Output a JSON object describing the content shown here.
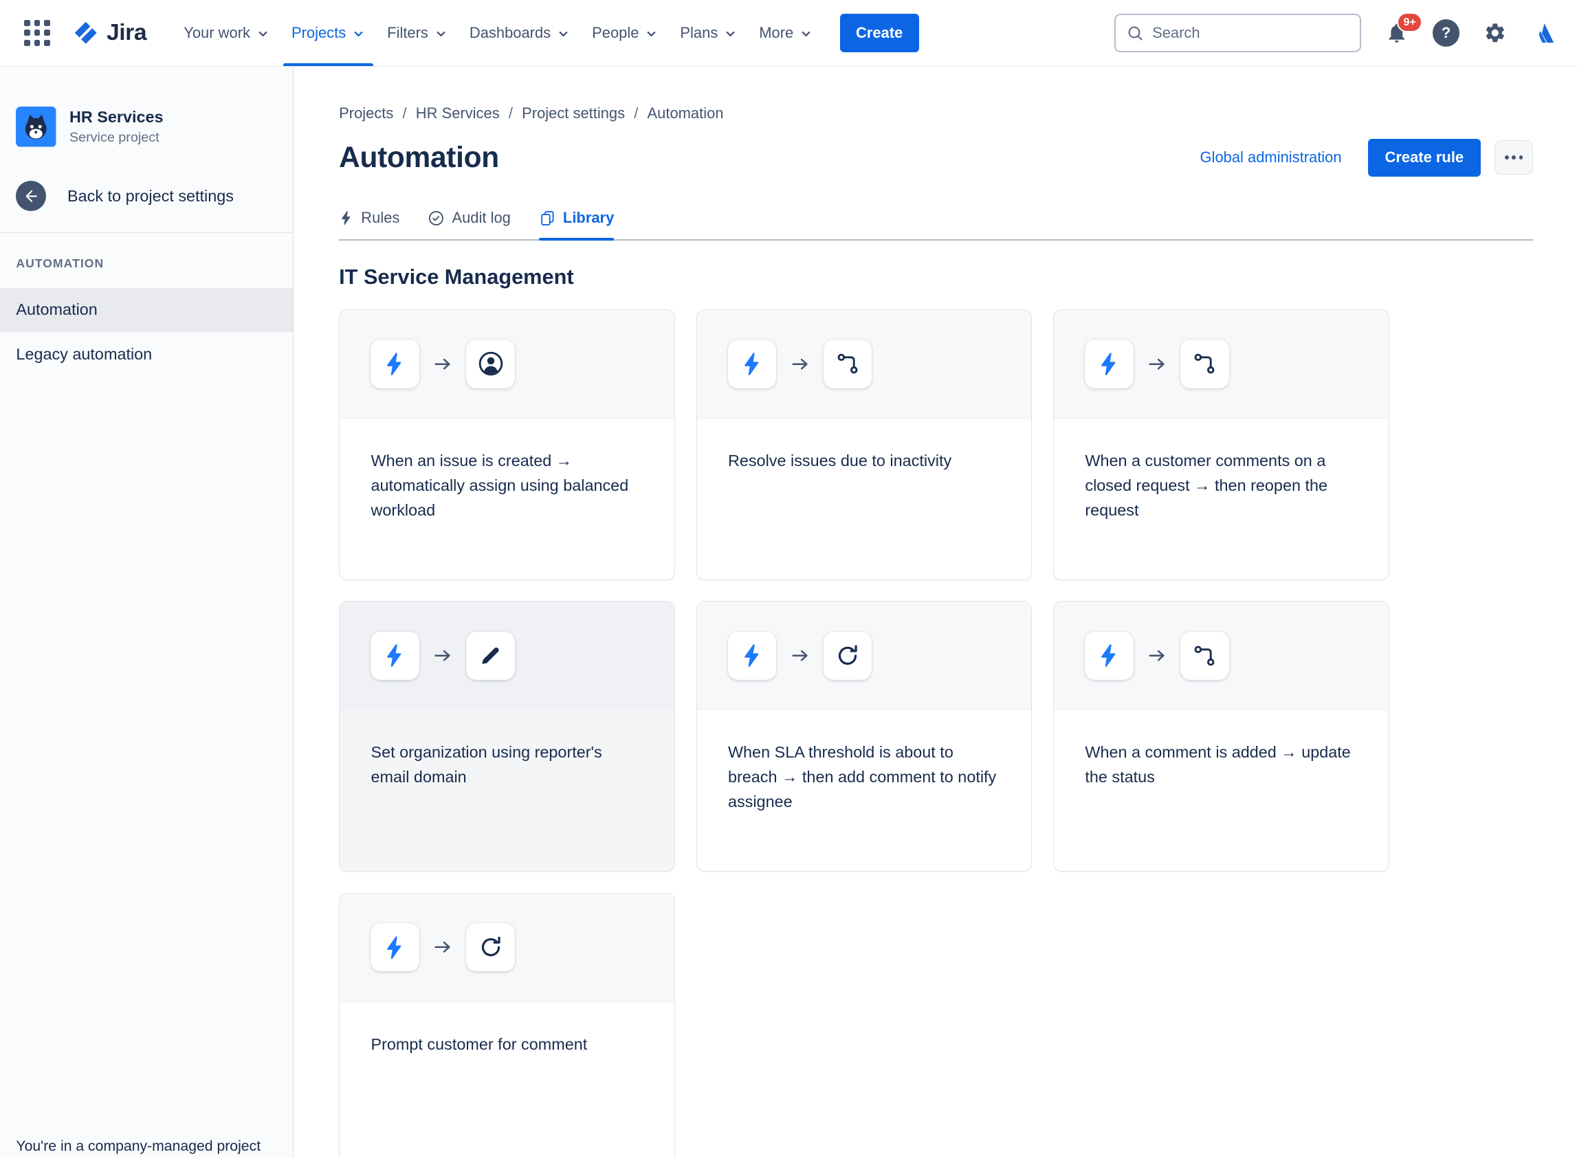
{
  "topbar": {
    "logo_text": "Jira",
    "nav": [
      {
        "label": "Your work"
      },
      {
        "label": "Projects",
        "active": true
      },
      {
        "label": "Filters"
      },
      {
        "label": "Dashboards"
      },
      {
        "label": "People"
      },
      {
        "label": "Plans"
      },
      {
        "label": "More"
      }
    ],
    "create_button": "Create",
    "search_placeholder": "Search",
    "notification_badge": "9+",
    "help_glyph": "?"
  },
  "sidebar": {
    "project_name": "HR Services",
    "project_type": "Service project",
    "back_link": "Back to project settings",
    "section_title": "AUTOMATION",
    "items": [
      {
        "label": "Automation",
        "selected": true
      },
      {
        "label": "Legacy automation",
        "selected": false
      }
    ],
    "footer_note": "You're in a company-managed project"
  },
  "main": {
    "breadcrumb": {
      "separator": "/",
      "items": [
        {
          "label": "Projects"
        },
        {
          "label": "HR Services"
        },
        {
          "label": "Project settings"
        },
        {
          "label": "Automation"
        }
      ]
    },
    "title": "Automation",
    "global_admin_link": "Global administration",
    "create_rule_button": "Create rule",
    "tabs": [
      {
        "label": "Rules",
        "icon": "lightning-icon",
        "active": false
      },
      {
        "label": "Audit log",
        "icon": "check-circle-icon",
        "active": false
      },
      {
        "label": "Library",
        "icon": "library-copy-icon",
        "active": true
      }
    ],
    "section_title": "IT Service Management",
    "cards": [
      {
        "icon": "user-icon",
        "text": "When an issue is created → automatically assign using balanced workload"
      },
      {
        "icon": "branch-icon",
        "text": "Resolve issues due to inactivity"
      },
      {
        "icon": "branch-icon",
        "text": "When a customer comments on a closed request → then reopen the request"
      },
      {
        "icon": "pencil-icon",
        "text": "Set organization using reporter's email domain"
      },
      {
        "icon": "refresh-icon",
        "text": "When SLA threshold is about to breach → then add comment to notify assignee"
      },
      {
        "icon": "branch-icon",
        "text": "When a comment is added → update the status"
      },
      {
        "icon": "refresh-icon",
        "text": "Prompt customer for comment"
      }
    ],
    "accent_color": "#0C66E4",
    "bolt_color": "#1D7AFC"
  }
}
